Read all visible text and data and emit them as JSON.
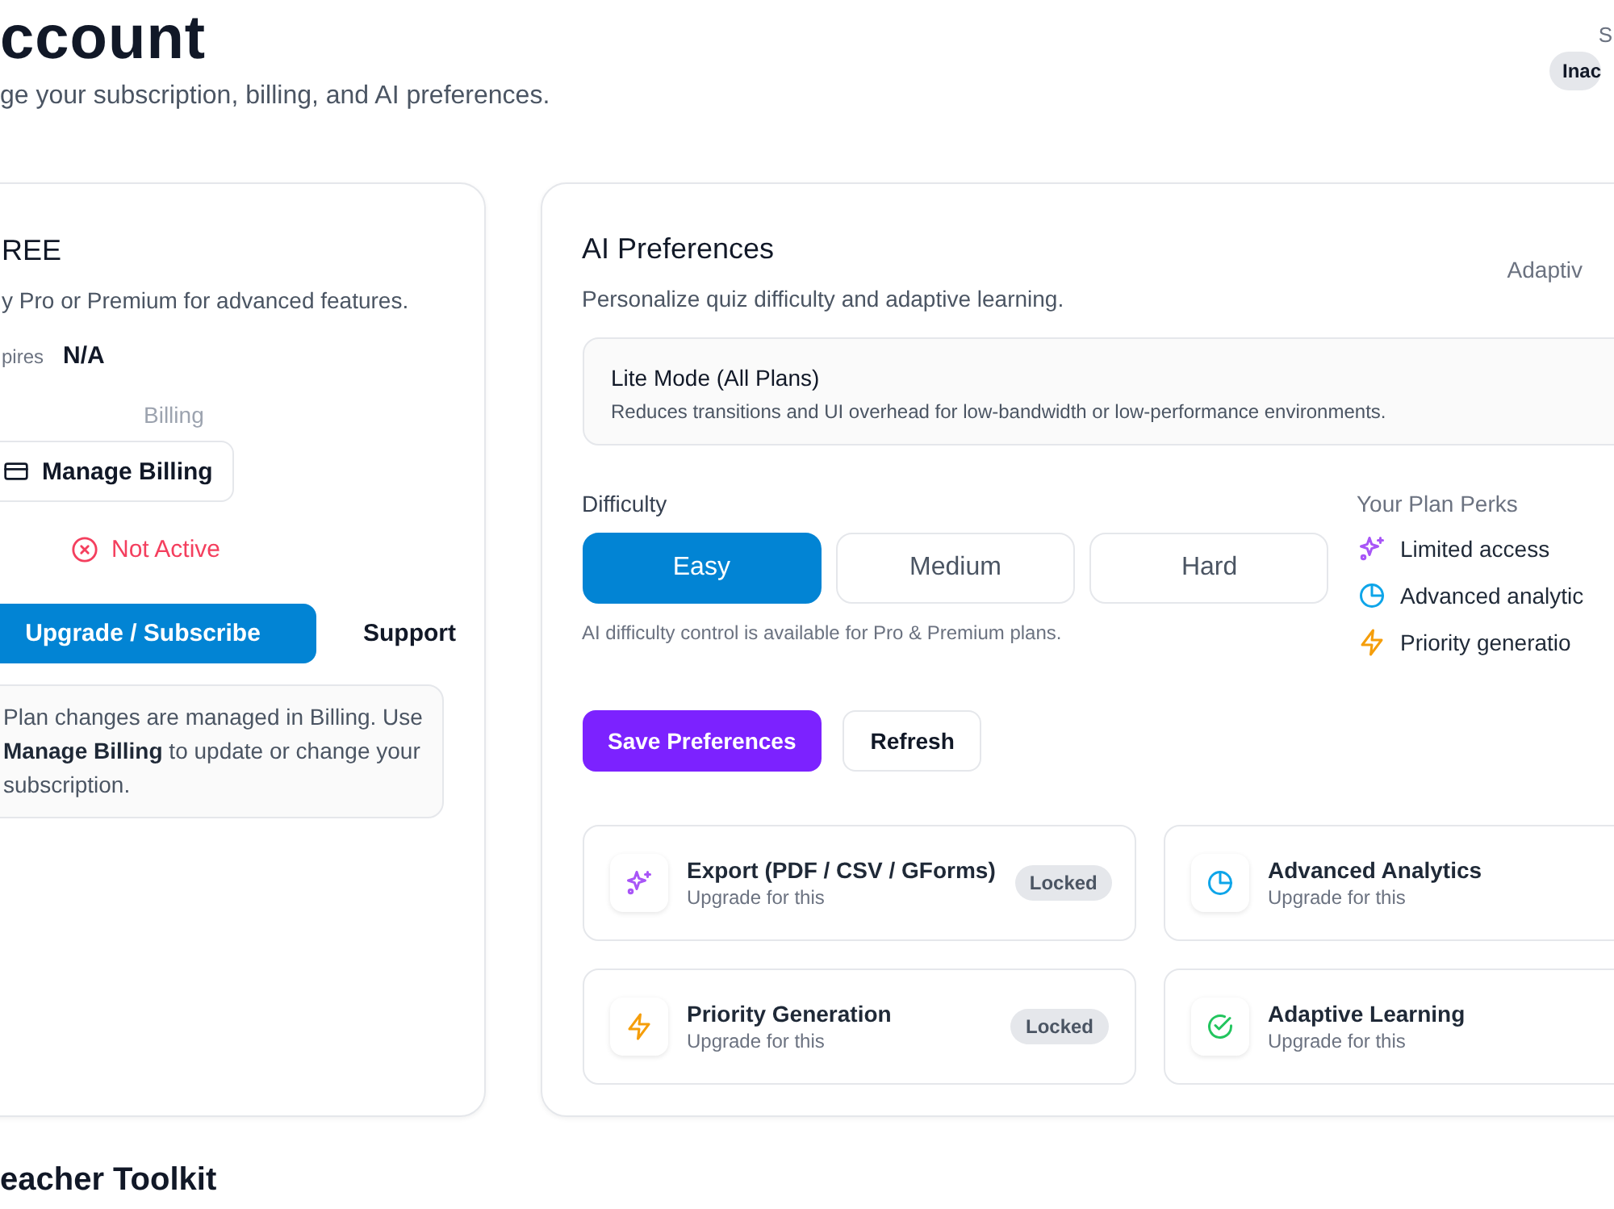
{
  "header": {
    "title": "ccount",
    "subtitle": "ge your subscription, billing, and AI preferences.",
    "status_label": "S",
    "status_badge": "Inac"
  },
  "plan_card": {
    "plan": "REE",
    "description": "y Pro or Premium for advanced features.",
    "expires_label": "pires",
    "expires_value": "N/A",
    "billing_label": "Billing",
    "manage_billing": "Manage Billing",
    "status": "Not Active",
    "upgrade": "Upgrade / Subscribe",
    "support": "Support",
    "note": "Plan changes are managed in Billing. Use **Manage Billing** to update or change your subscription."
  },
  "ai_card": {
    "title": "AI Preferences",
    "subtitle": "Personalize quiz difficulty and adaptive learning.",
    "header_right": "Adaptiv",
    "lite_mode": {
      "title": "Lite Mode (All Plans)",
      "description": "Reduces transitions and UI overhead for low-bandwidth or low-performance environments."
    },
    "difficulty_label": "Difficulty",
    "difficulty": [
      {
        "label": "Easy",
        "selected": true
      },
      {
        "label": "Medium",
        "selected": false
      },
      {
        "label": "Hard",
        "selected": false
      }
    ],
    "difficulty_note": "AI difficulty control is available for Pro & Premium plans.",
    "perks_title": "Your Plan Perks",
    "perks": [
      {
        "label": "Limited access",
        "color": "#a855f7"
      },
      {
        "label": "Advanced analytic",
        "color": "#0ea5e9"
      },
      {
        "label": "Priority generatio",
        "color": "#f59e0b"
      }
    ],
    "save": "Save Preferences",
    "refresh": "Refresh",
    "features": [
      {
        "title": "Export (PDF / CSV / GForms)",
        "subtitle": "Upgrade for this",
        "badge": "Locked",
        "color": "#a855f7"
      },
      {
        "title": "Advanced Analytics",
        "subtitle": "Upgrade for this",
        "color": "#0ea5e9"
      },
      {
        "title": "Priority Generation",
        "subtitle": "Upgrade for this",
        "badge": "Locked",
        "color": "#f59e0b"
      },
      {
        "title": "Adaptive Learning",
        "subtitle": "Upgrade for this",
        "color": "#22c55e"
      }
    ]
  },
  "next_section": {
    "title": "eacher Toolkit"
  }
}
